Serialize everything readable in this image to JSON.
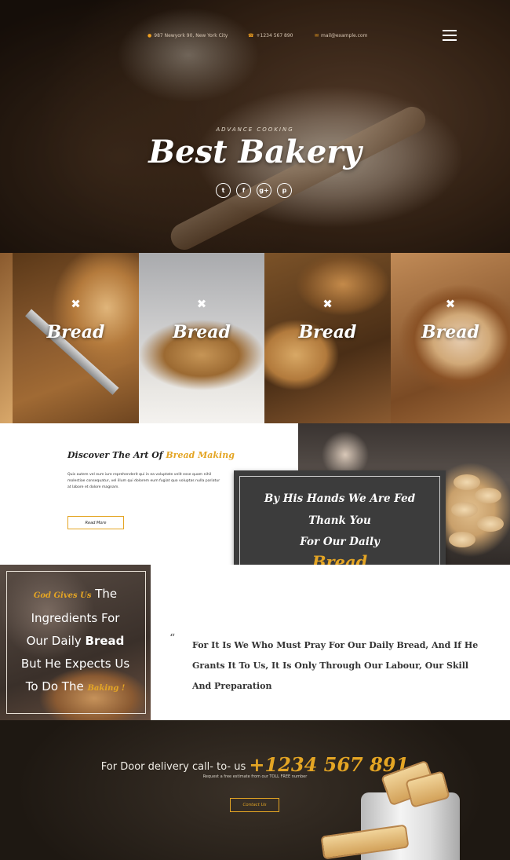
{
  "header": {
    "address": "987 Newyork 90, New York City",
    "phone": "+1234 567 890",
    "email": "mail@example.com",
    "tagline": "ADVANCE COOKING",
    "title": "Best Bakery",
    "socials": [
      "t",
      "f",
      "g+",
      "p"
    ]
  },
  "gallery": {
    "items": [
      "Bread",
      "Bread",
      "Bread",
      "Bread"
    ]
  },
  "discover": {
    "title_pre": "Discover The Art Of ",
    "title_accent": "Bread Making",
    "text": "Quis autem vel eum iure reprehenderit qui in ea voluptate velit esse quam nihil molestiae consequatur, vel illum qui dolorem eum fugiat quo voluptas nulla pariatur at labore et dolore magnam.",
    "button": "Read More"
  },
  "quote_box": {
    "line1": "By His Hands We Are Fed",
    "line2": "Thank You",
    "line3": "For Our Daily",
    "accent": "Bread"
  },
  "ingredients": {
    "accent1": "God Gives Us",
    "w1": "The",
    "w2": "Ingredients For",
    "w3": "Our Daily",
    "w3b": "Bread",
    "w4": "But He Expects Us",
    "w5": "To Do The",
    "accent2": "Baking !"
  },
  "big_quote": {
    "mark": "“",
    "text": "For It Is We Who Must Pray For Our Daily Bread, And If He Grants It To Us, It Is Only Through Our Labour, Our Skill And Preparation"
  },
  "delivery": {
    "label": "For Door delivery call- to- us",
    "phone": "+1234 567 891",
    "sub": "Request a free estimate from our TOLL FREE number",
    "button": "Contact Us"
  },
  "colors": {
    "accent": "#e4a524",
    "dark_panel": "#3c3c3c"
  },
  "icons": [
    "map-pin-icon",
    "phone-icon",
    "mail-icon",
    "hamburger-menu-icon",
    "twitter-icon",
    "facebook-icon",
    "google-plus-icon",
    "pinterest-icon",
    "fork-knife-icon",
    "quote-mark-icon"
  ]
}
